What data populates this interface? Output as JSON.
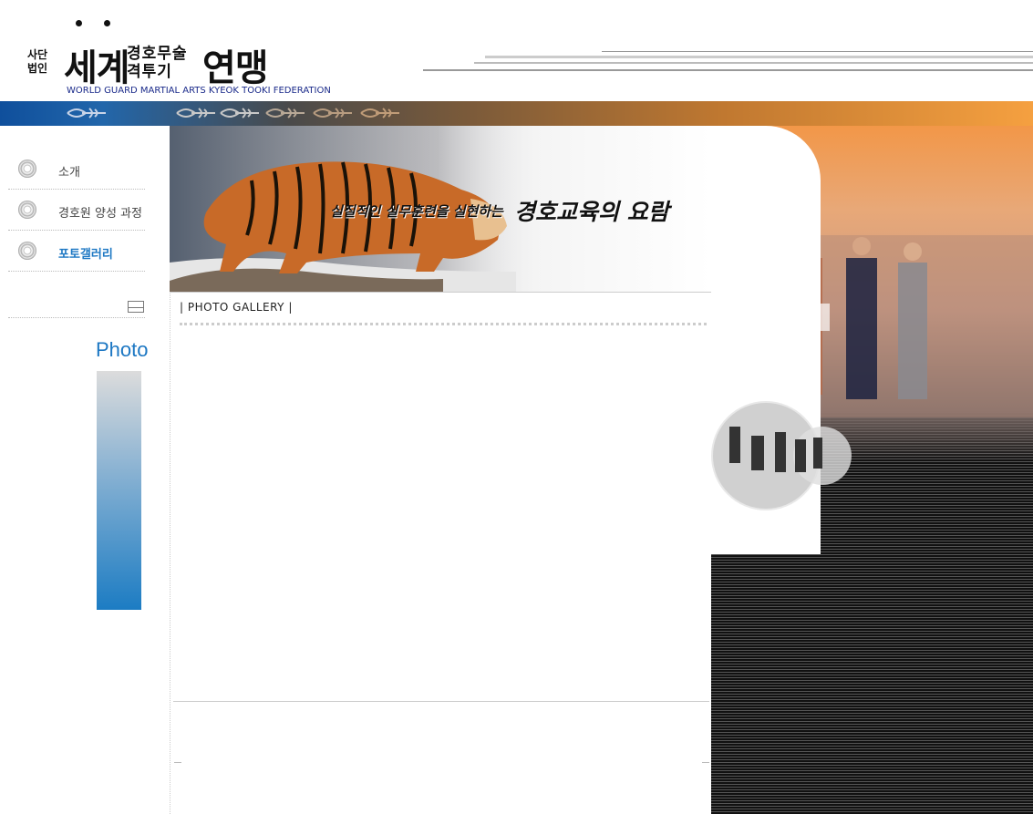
{
  "header": {
    "corp_line1": "사단",
    "corp_line2": "법인",
    "title_part1": "세계",
    "mid_line1": "경호무술",
    "mid_line2": "격투기",
    "title_part2": "연맹",
    "subtitle": "WORLD GUARD MARTIAL ARTS KYEOK TOOKI FEDERATION"
  },
  "sidebar": {
    "items": [
      {
        "label": "소개",
        "active": false
      },
      {
        "label": "경호원 양성 과정",
        "active": false
      },
      {
        "label": "포토갤러리",
        "active": true
      }
    ],
    "section_title": "Photo"
  },
  "banner": {
    "tagline_small": "실질적인 실무훈련을 실현하는",
    "tagline_big": "경호교육의 요람"
  },
  "main": {
    "page_title": "| PHOTO GALLERY |"
  },
  "colors": {
    "accent_blue": "#1c77c3",
    "bar_blue": "#0f4f9c",
    "bar_orange": "#f5a040"
  },
  "icons": [
    "circle-bullet-icon",
    "mail-icon",
    "ornament-icon"
  ]
}
